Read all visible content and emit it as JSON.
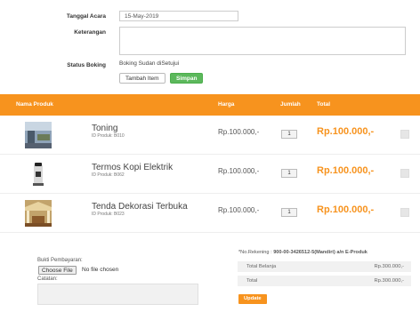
{
  "form": {
    "tanggal_label": "Tanggal Acara",
    "tanggal_value": "15-May-2019",
    "keterangan_label": "Keterangan",
    "keterangan_value": "",
    "status_label": "Status Boking",
    "status_value": "Boking Sudan diSetujui",
    "tambah_label": "Tambah Item",
    "simpan_label": "Simpan"
  },
  "table": {
    "headers": [
      "Nama Produk",
      "Harga",
      "Jumlah",
      "Total"
    ],
    "rows": [
      {
        "name": "Toning",
        "id": "ID Produk: B010",
        "price": "Rp.100.000,-",
        "qty": "1",
        "total": "Rp.100.000,-"
      },
      {
        "name": "Termos Kopi Elektrik",
        "id": "ID Produk: B062",
        "price": "Rp.100.000,-",
        "qty": "1",
        "total": "Rp.100.000,-"
      },
      {
        "name": "Tenda Dekorasi Terbuka",
        "id": "ID Produk: B023",
        "price": "Rp.100.000,-",
        "qty": "1",
        "total": "Rp.100.000,-"
      }
    ]
  },
  "payment": {
    "bukti_label": "Bukti Pembayaran:",
    "choose_file": "Choose File",
    "no_file": "No file chosen",
    "catatan_label": "Catatan:"
  },
  "summary": {
    "rekening_prefix": "*No.Rekening : ",
    "rekening_value": "900-00-3426512-5(Mandiri) a/n E-Produk",
    "total_belanja_label": "Total Belanja",
    "total_belanja_value": "Rp.300.000,-",
    "total_label": "Total",
    "total_value": "Rp.300.000,-",
    "update_label": "Update"
  },
  "colors": {
    "accent": "#f7931e",
    "green": "#5cb85c"
  }
}
